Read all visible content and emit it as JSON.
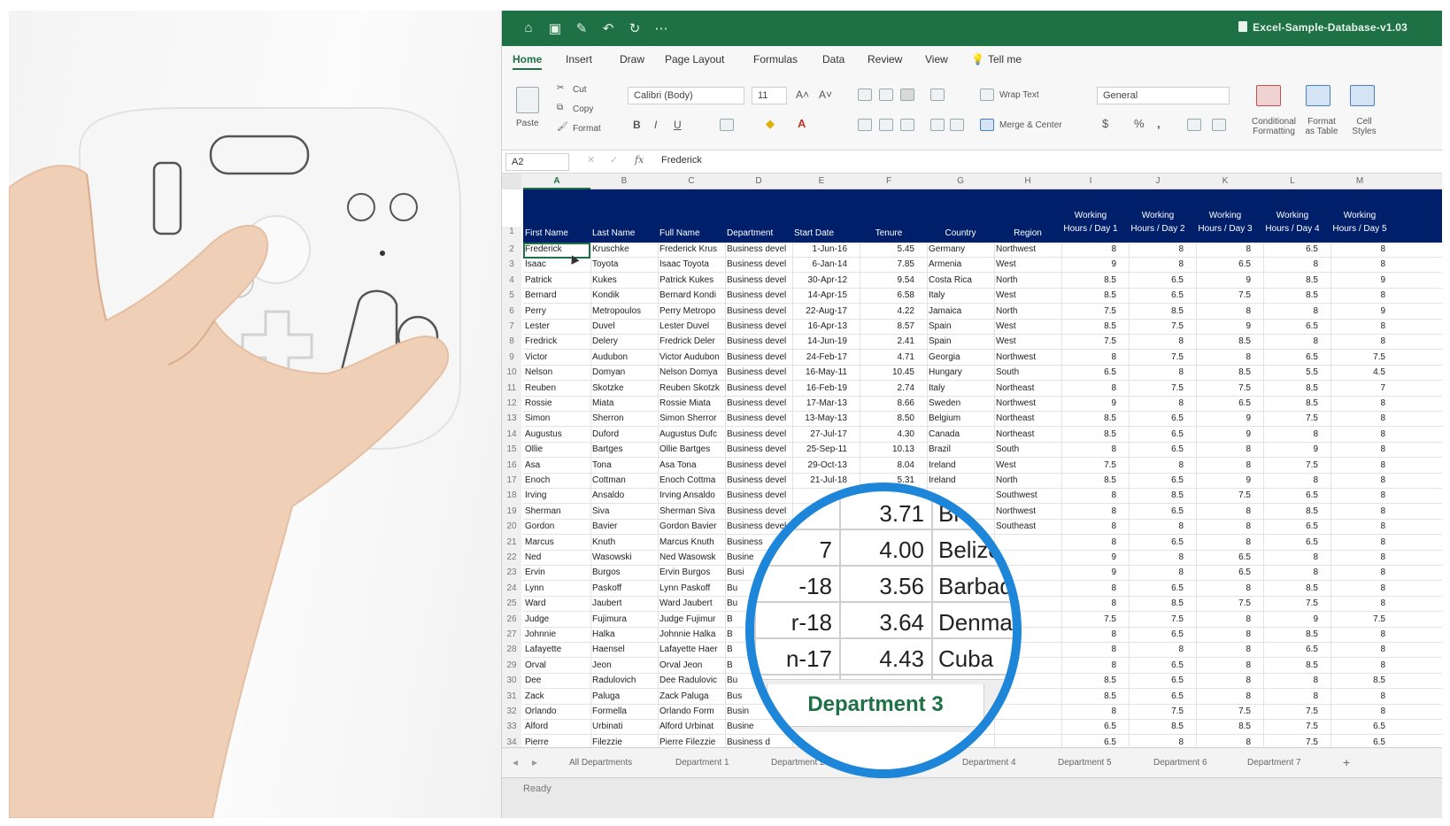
{
  "excel": {
    "doc_title": "Excel-Sample-Database-v1.03",
    "tabs": [
      "Home",
      "Insert",
      "Draw",
      "Page Layout",
      "Formulas",
      "Data",
      "Review",
      "View",
      "Tell me"
    ],
    "ribbon": {
      "clipboard": {
        "paste": "Paste",
        "cut": "Cut",
        "copy": "Copy",
        "format": "Format"
      },
      "font_name": "Calibri (Body)",
      "font_size": "11",
      "wrap_text": "Wrap Text",
      "merge_center": "Merge & Center",
      "number_format": "General",
      "conditional_formatting": "Conditional Formatting",
      "format_as_table": "Format as Table",
      "cell_styles": "Cell Styles"
    },
    "name_box": "A2",
    "formula_value": "Frederick",
    "columns": [
      "A",
      "B",
      "C",
      "D",
      "E",
      "F",
      "G",
      "H",
      "I",
      "J",
      "K",
      "L",
      "M"
    ],
    "headers": [
      "First Name",
      "Last Name",
      "Full Name",
      "Department",
      "Start Date",
      "Tenure",
      "Country",
      "Region",
      "Working Hours / Day 1",
      "Working Hours / Day 2",
      "Working Hours / Day 3",
      "Working Hours / Day 4",
      "Working Hours / Day 5"
    ],
    "rows": [
      {
        "n": "2",
        "c": [
          "Frederick",
          "Kruschke",
          "Frederick Krus",
          "Business devel",
          "1-Jun-16",
          "5.45",
          "Germany",
          "Northwest",
          "8",
          "8",
          "8",
          "6.5",
          "8"
        ]
      },
      {
        "n": "3",
        "c": [
          "Isaac",
          "Toyota",
          "Isaac Toyota",
          "Business devel",
          "6-Jan-14",
          "7.85",
          "Armenia",
          "West",
          "9",
          "8",
          "6.5",
          "8",
          "8"
        ]
      },
      {
        "n": "4",
        "c": [
          "Patrick",
          "Kukes",
          "Patrick Kukes",
          "Business devel",
          "30-Apr-12",
          "9.54",
          "Costa Rica",
          "North",
          "8.5",
          "6.5",
          "9",
          "8.5",
          "9"
        ]
      },
      {
        "n": "5",
        "c": [
          "Bernard",
          "Kondik",
          "Bernard Kondi",
          "Business devel",
          "14-Apr-15",
          "6.58",
          "Italy",
          "West",
          "8.5",
          "6.5",
          "7.5",
          "8.5",
          "8"
        ]
      },
      {
        "n": "6",
        "c": [
          "Perry",
          "Metropoulos",
          "Perry Metropo",
          "Business devel",
          "22-Aug-17",
          "4.22",
          "Jamaica",
          "North",
          "7.5",
          "8.5",
          "8",
          "8",
          "9"
        ]
      },
      {
        "n": "7",
        "c": [
          "Lester",
          "Duvel",
          "Lester Duvel",
          "Business devel",
          "16-Apr-13",
          "8.57",
          "Spain",
          "West",
          "8.5",
          "7.5",
          "9",
          "6.5",
          "8"
        ]
      },
      {
        "n": "8",
        "c": [
          "Fredrick",
          "Delery",
          "Fredrick Deler",
          "Business devel",
          "14-Jun-19",
          "2.41",
          "Spain",
          "West",
          "7.5",
          "8",
          "8.5",
          "8",
          "8"
        ]
      },
      {
        "n": "9",
        "c": [
          "Victor",
          "Audubon",
          "Victor Audubon",
          "Business devel",
          "24-Feb-17",
          "4.71",
          "Georgia",
          "Northwest",
          "8",
          "7.5",
          "8",
          "6.5",
          "7.5"
        ]
      },
      {
        "n": "10",
        "c": [
          "Nelson",
          "Domyan",
          "Nelson Domya",
          "Business devel",
          "16-May-11",
          "10.45",
          "Hungary",
          "South",
          "6.5",
          "8",
          "8.5",
          "5.5",
          "4.5"
        ]
      },
      {
        "n": "11",
        "c": [
          "Reuben",
          "Skotzke",
          "Reuben Skotzk",
          "Business devel",
          "16-Feb-19",
          "2.74",
          "Italy",
          "Northeast",
          "8",
          "7.5",
          "7.5",
          "8.5",
          "7"
        ]
      },
      {
        "n": "12",
        "c": [
          "Rossie",
          "Miata",
          "Rossie Miata",
          "Business devel",
          "17-Mar-13",
          "8.66",
          "Sweden",
          "Northwest",
          "9",
          "8",
          "6.5",
          "8.5",
          "8"
        ]
      },
      {
        "n": "13",
        "c": [
          "Simon",
          "Sherron",
          "Simon Sherror",
          "Business devel",
          "13-May-13",
          "8.50",
          "Belgium",
          "Northeast",
          "8.5",
          "6.5",
          "9",
          "7.5",
          "8"
        ]
      },
      {
        "n": "14",
        "c": [
          "Augustus",
          "Duford",
          "Augustus Dufc",
          "Business devel",
          "27-Jul-17",
          "4.30",
          "Canada",
          "Northeast",
          "8.5",
          "6.5",
          "9",
          "8",
          "8"
        ]
      },
      {
        "n": "15",
        "c": [
          "Ollie",
          "Bartges",
          "Ollie Bartges",
          "Business devel",
          "25-Sep-11",
          "10.13",
          "Brazil",
          "South",
          "8",
          "6.5",
          "8",
          "9",
          "8"
        ]
      },
      {
        "n": "16",
        "c": [
          "Asa",
          "Tona",
          "Asa Tona",
          "Business devel",
          "29-Oct-13",
          "8.04",
          "Ireland",
          "West",
          "7.5",
          "8",
          "8",
          "7.5",
          "8"
        ]
      },
      {
        "n": "17",
        "c": [
          "Enoch",
          "Cottman",
          "Enoch Cottma",
          "Business devel",
          "21-Jul-18",
          "5.31",
          "Ireland",
          "North",
          "8.5",
          "6.5",
          "9",
          "8",
          "8"
        ]
      },
      {
        "n": "18",
        "c": [
          "Irving",
          "Ansaldo",
          "Irving Ansaldo",
          "Business devel",
          "",
          "",
          "",
          "Southwest",
          "8",
          "8.5",
          "7.5",
          "6.5",
          "8"
        ]
      },
      {
        "n": "19",
        "c": [
          "Sherman",
          "Siva",
          "Sherman Siva",
          "Business devel",
          "",
          "",
          "",
          "Northwest",
          "8",
          "6.5",
          "8",
          "8.5",
          "8"
        ]
      },
      {
        "n": "20",
        "c": [
          "Gordon",
          "Bavier",
          "Gordon Bavier",
          "Business devel",
          "",
          "",
          "",
          "Southeast",
          "8",
          "8",
          "8",
          "6.5",
          "8"
        ]
      },
      {
        "n": "21",
        "c": [
          "Marcus",
          "Knuth",
          "Marcus Knuth",
          "Business",
          "",
          "",
          "",
          "",
          "8",
          "6.5",
          "8",
          "6.5",
          "8"
        ]
      },
      {
        "n": "22",
        "c": [
          "Ned",
          "Wasowski",
          "Ned Wasowsk",
          "Busine",
          "",
          "",
          "",
          "",
          "9",
          "8",
          "6.5",
          "8",
          "8"
        ]
      },
      {
        "n": "23",
        "c": [
          "Ervin",
          "Burgos",
          "Ervin Burgos",
          "Busi",
          "",
          "",
          "",
          "",
          "9",
          "8",
          "6.5",
          "8",
          "8"
        ]
      },
      {
        "n": "24",
        "c": [
          "Lynn",
          "Paskoff",
          "Lynn Paskoff",
          "Bu",
          "",
          "",
          "",
          "",
          "8",
          "6.5",
          "8",
          "8.5",
          "8"
        ]
      },
      {
        "n": "25",
        "c": [
          "Ward",
          "Jaubert",
          "Ward Jaubert",
          "Bu",
          "",
          "",
          "",
          "",
          "8",
          "8.5",
          "7.5",
          "7.5",
          "8"
        ]
      },
      {
        "n": "26",
        "c": [
          "Judge",
          "Fujimura",
          "Judge Fujimur",
          "B",
          "",
          "",
          "",
          "",
          "7.5",
          "7.5",
          "8",
          "9",
          "7.5"
        ]
      },
      {
        "n": "27",
        "c": [
          "Johnnie",
          "Halka",
          "Johnnie Halka",
          "B",
          "",
          "",
          "",
          "",
          "8",
          "6.5",
          "8",
          "8.5",
          "8"
        ]
      },
      {
        "n": "28",
        "c": [
          "Lafayette",
          "Haensel",
          "Lafayette Haer",
          "B",
          "",
          "",
          "",
          "",
          "8",
          "8",
          "8",
          "6.5",
          "8"
        ]
      },
      {
        "n": "29",
        "c": [
          "Orval",
          "Jeon",
          "Orval Jeon",
          "B",
          "",
          "",
          "",
          "",
          "8",
          "6.5",
          "8",
          "8.5",
          "8"
        ]
      },
      {
        "n": "30",
        "c": [
          "Dee",
          "Radulovich",
          "Dee Radulovic",
          "Bu",
          "",
          "",
          "",
          "",
          "8.5",
          "6.5",
          "8",
          "8",
          "8.5"
        ]
      },
      {
        "n": "31",
        "c": [
          "Zack",
          "Paluga",
          "Zack Paluga",
          "Bus",
          "",
          "",
          "",
          "",
          "8.5",
          "6.5",
          "8",
          "8",
          "8"
        ]
      },
      {
        "n": "32",
        "c": [
          "Orlando",
          "Formella",
          "Orlando Form",
          "Busin",
          "",
          "",
          "",
          "",
          "8",
          "7.5",
          "7.5",
          "7.5",
          "8"
        ]
      },
      {
        "n": "33",
        "c": [
          "Alford",
          "Urbinati",
          "Alford Urbinat",
          "Busine",
          "",
          "",
          "",
          "",
          "6.5",
          "8.5",
          "8.5",
          "7.5",
          "6.5"
        ]
      },
      {
        "n": "34",
        "c": [
          "Pierre",
          "Filezzie",
          "Pierre Filezzie",
          "Business d",
          "",
          "",
          "",
          "",
          "6.5",
          "8",
          "8",
          "7.5",
          "6.5"
        ]
      }
    ],
    "sheet_tabs": [
      "All Departments",
      "Department 1",
      "Department 2",
      "Department 3",
      "Department 4",
      "Department 5",
      "Department 6",
      "Department 7"
    ],
    "add_sheet": "+",
    "status": "Ready",
    "magnifier": {
      "rows": [
        {
          "left": "",
          "tenure": "3.71",
          "country": "Br"
        },
        {
          "left": "7",
          "tenure": "4.00",
          "country": "Belize"
        },
        {
          "left": "-18",
          "tenure": "3.56",
          "country": "Barbad"
        },
        {
          "left": "r-18",
          "tenure": "3.64",
          "country": "Denmar"
        },
        {
          "left": "n-17",
          "tenure": "4.43",
          "country": "Cuba"
        }
      ],
      "tab_label": "Department 3"
    },
    "colors": {
      "title_green": "#1e7145",
      "header_navy": "#001f6b",
      "magnifier_ring": "#1d86d8"
    }
  }
}
